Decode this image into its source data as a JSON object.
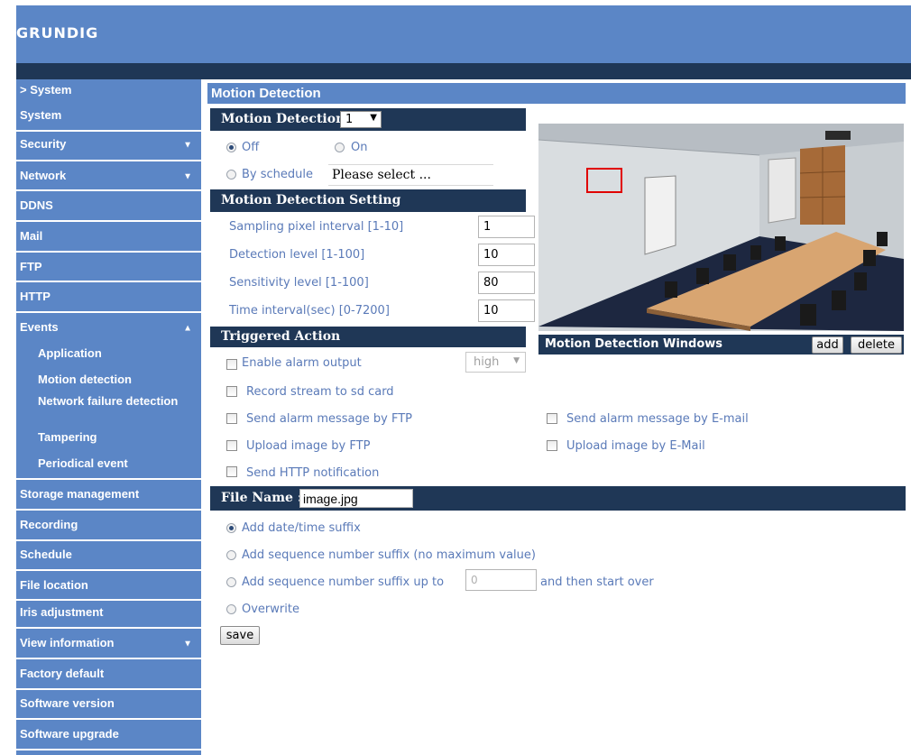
{
  "brand": "GRUNDIG",
  "sidebar": {
    "system_header": "> System",
    "items": [
      {
        "label": "System"
      },
      {
        "label": "Security",
        "arrow": "▼"
      },
      {
        "label": "Network",
        "arrow": "▼"
      },
      {
        "label": "DDNS"
      },
      {
        "label": "Mail"
      },
      {
        "label": "FTP"
      },
      {
        "label": "HTTP"
      },
      {
        "label": "Events",
        "arrow": "▲"
      }
    ],
    "events_sub": [
      "Application",
      "Motion detection",
      "Network failure detection",
      "Tampering",
      "Periodical event"
    ],
    "items_after": [
      {
        "label": "Storage management"
      },
      {
        "label": "Recording"
      },
      {
        "label": "Schedule"
      },
      {
        "label": "File location"
      },
      {
        "label": "Iris adjustment"
      },
      {
        "label": "View information",
        "arrow": "▼"
      },
      {
        "label": "Factory default"
      },
      {
        "label": "Software version"
      },
      {
        "label": "Software upgrade"
      }
    ]
  },
  "main": {
    "title": "Motion Detection",
    "md_section": "Motion Detection",
    "md_select_value": "1",
    "off_label": "Off",
    "on_label": "On",
    "schedule_label": "By schedule",
    "schedule_value": "Please select ...",
    "setting_section": "Motion Detection Setting",
    "settings": [
      {
        "label": "Sampling pixel interval [1-10]",
        "value": "1"
      },
      {
        "label": "Detection level [1-100]",
        "value": "10"
      },
      {
        "label": "Sensitivity level [1-100]",
        "value": "80"
      },
      {
        "label": "Time interval(sec) [0-7200]",
        "value": "10"
      }
    ],
    "triggered_section": "Triggered Action",
    "enable_alarm": "Enable alarm output",
    "alarm_level": "high",
    "actions_left": [
      "Record stream to sd card",
      "Send alarm message by FTP",
      "Upload image by FTP",
      "Send HTTP notification"
    ],
    "actions_right": [
      "Send alarm message by E-mail",
      "Upload image by E-Mail"
    ],
    "windows_label": "Motion Detection Windows",
    "add_label": "add",
    "delete_label": "delete",
    "filename_label": "File Name :",
    "filename_value": "image.jpg",
    "suffix_date": "Add date/time suffix",
    "suffix_seq": "Add sequence number suffix (no maximum value)",
    "suffix_upto": "Add sequence number suffix up to",
    "suffix_upto_value": "0",
    "suffix_upto_after": "and then start over",
    "overwrite": "Overwrite",
    "save_label": "save"
  },
  "colors": {
    "header_blue": "#5b86c6",
    "dark_navy": "#1f3756",
    "label_text": "#5a7ab8"
  }
}
